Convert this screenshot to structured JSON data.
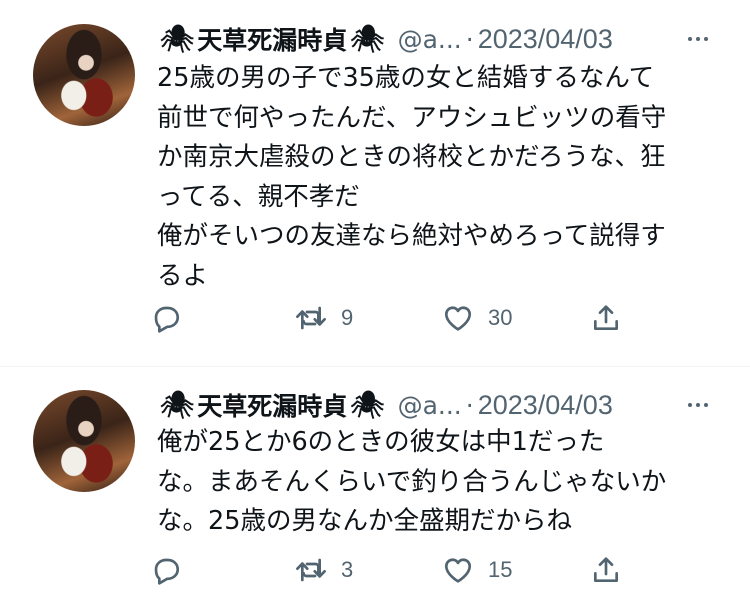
{
  "tweets": [
    {
      "user": {
        "spider_left": "🕷",
        "display_name": "天草死漏時貞",
        "spider_right": "🕷",
        "handle": "@a...",
        "separator": "·"
      },
      "date": "2023/04/03",
      "text": "25歳の男の子で35歳の女と結婚するなんて\n前世で何やったんだ、アウシュビッツの看守\nか南京大虐殺のときの将校とかだろうな、狂\nってる、親不孝だ\n俺がそいつの友達なら絶対やめろって説得す\nるよ",
      "actions": {
        "retweets": "9",
        "likes": "30"
      }
    },
    {
      "user": {
        "spider_left": "🕷",
        "display_name": "天草死漏時貞",
        "spider_right": "🕷",
        "handle": "@a...",
        "separator": "·"
      },
      "date": "2023/04/03",
      "text": "俺が25とか6のときの彼女は中1だった\nな。まあそんくらいで釣り合うんじゃないか\nな。25歳の男なんか全盛期だからね",
      "actions": {
        "retweets": "3",
        "likes": "15"
      }
    }
  ],
  "icons": {
    "reply": "speech-bubble",
    "retweet": "retweet-arrows",
    "like": "heart",
    "share": "upload-arrow",
    "more": "three-dots"
  },
  "colors": {
    "text": "#0f1419",
    "secondary": "#536471",
    "divider": "#eff3f4"
  }
}
